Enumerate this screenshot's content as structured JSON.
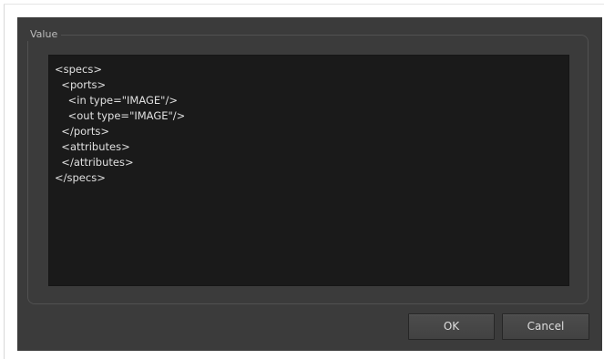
{
  "dialog": {
    "group_title": "Value",
    "code_lines": [
      "<specs>",
      "  <ports>",
      "    <in type=\"IMAGE\"/>",
      "    <out type=\"IMAGE\"/>",
      "  </ports>",
      "  <attributes>",
      "  </attributes>",
      "</specs>"
    ],
    "ok_label": "OK",
    "cancel_label": "Cancel"
  },
  "colors": {
    "dialog_background": "#3b3b3b",
    "editor_background": "#1a1a1a",
    "text": "#e0e0e0"
  }
}
